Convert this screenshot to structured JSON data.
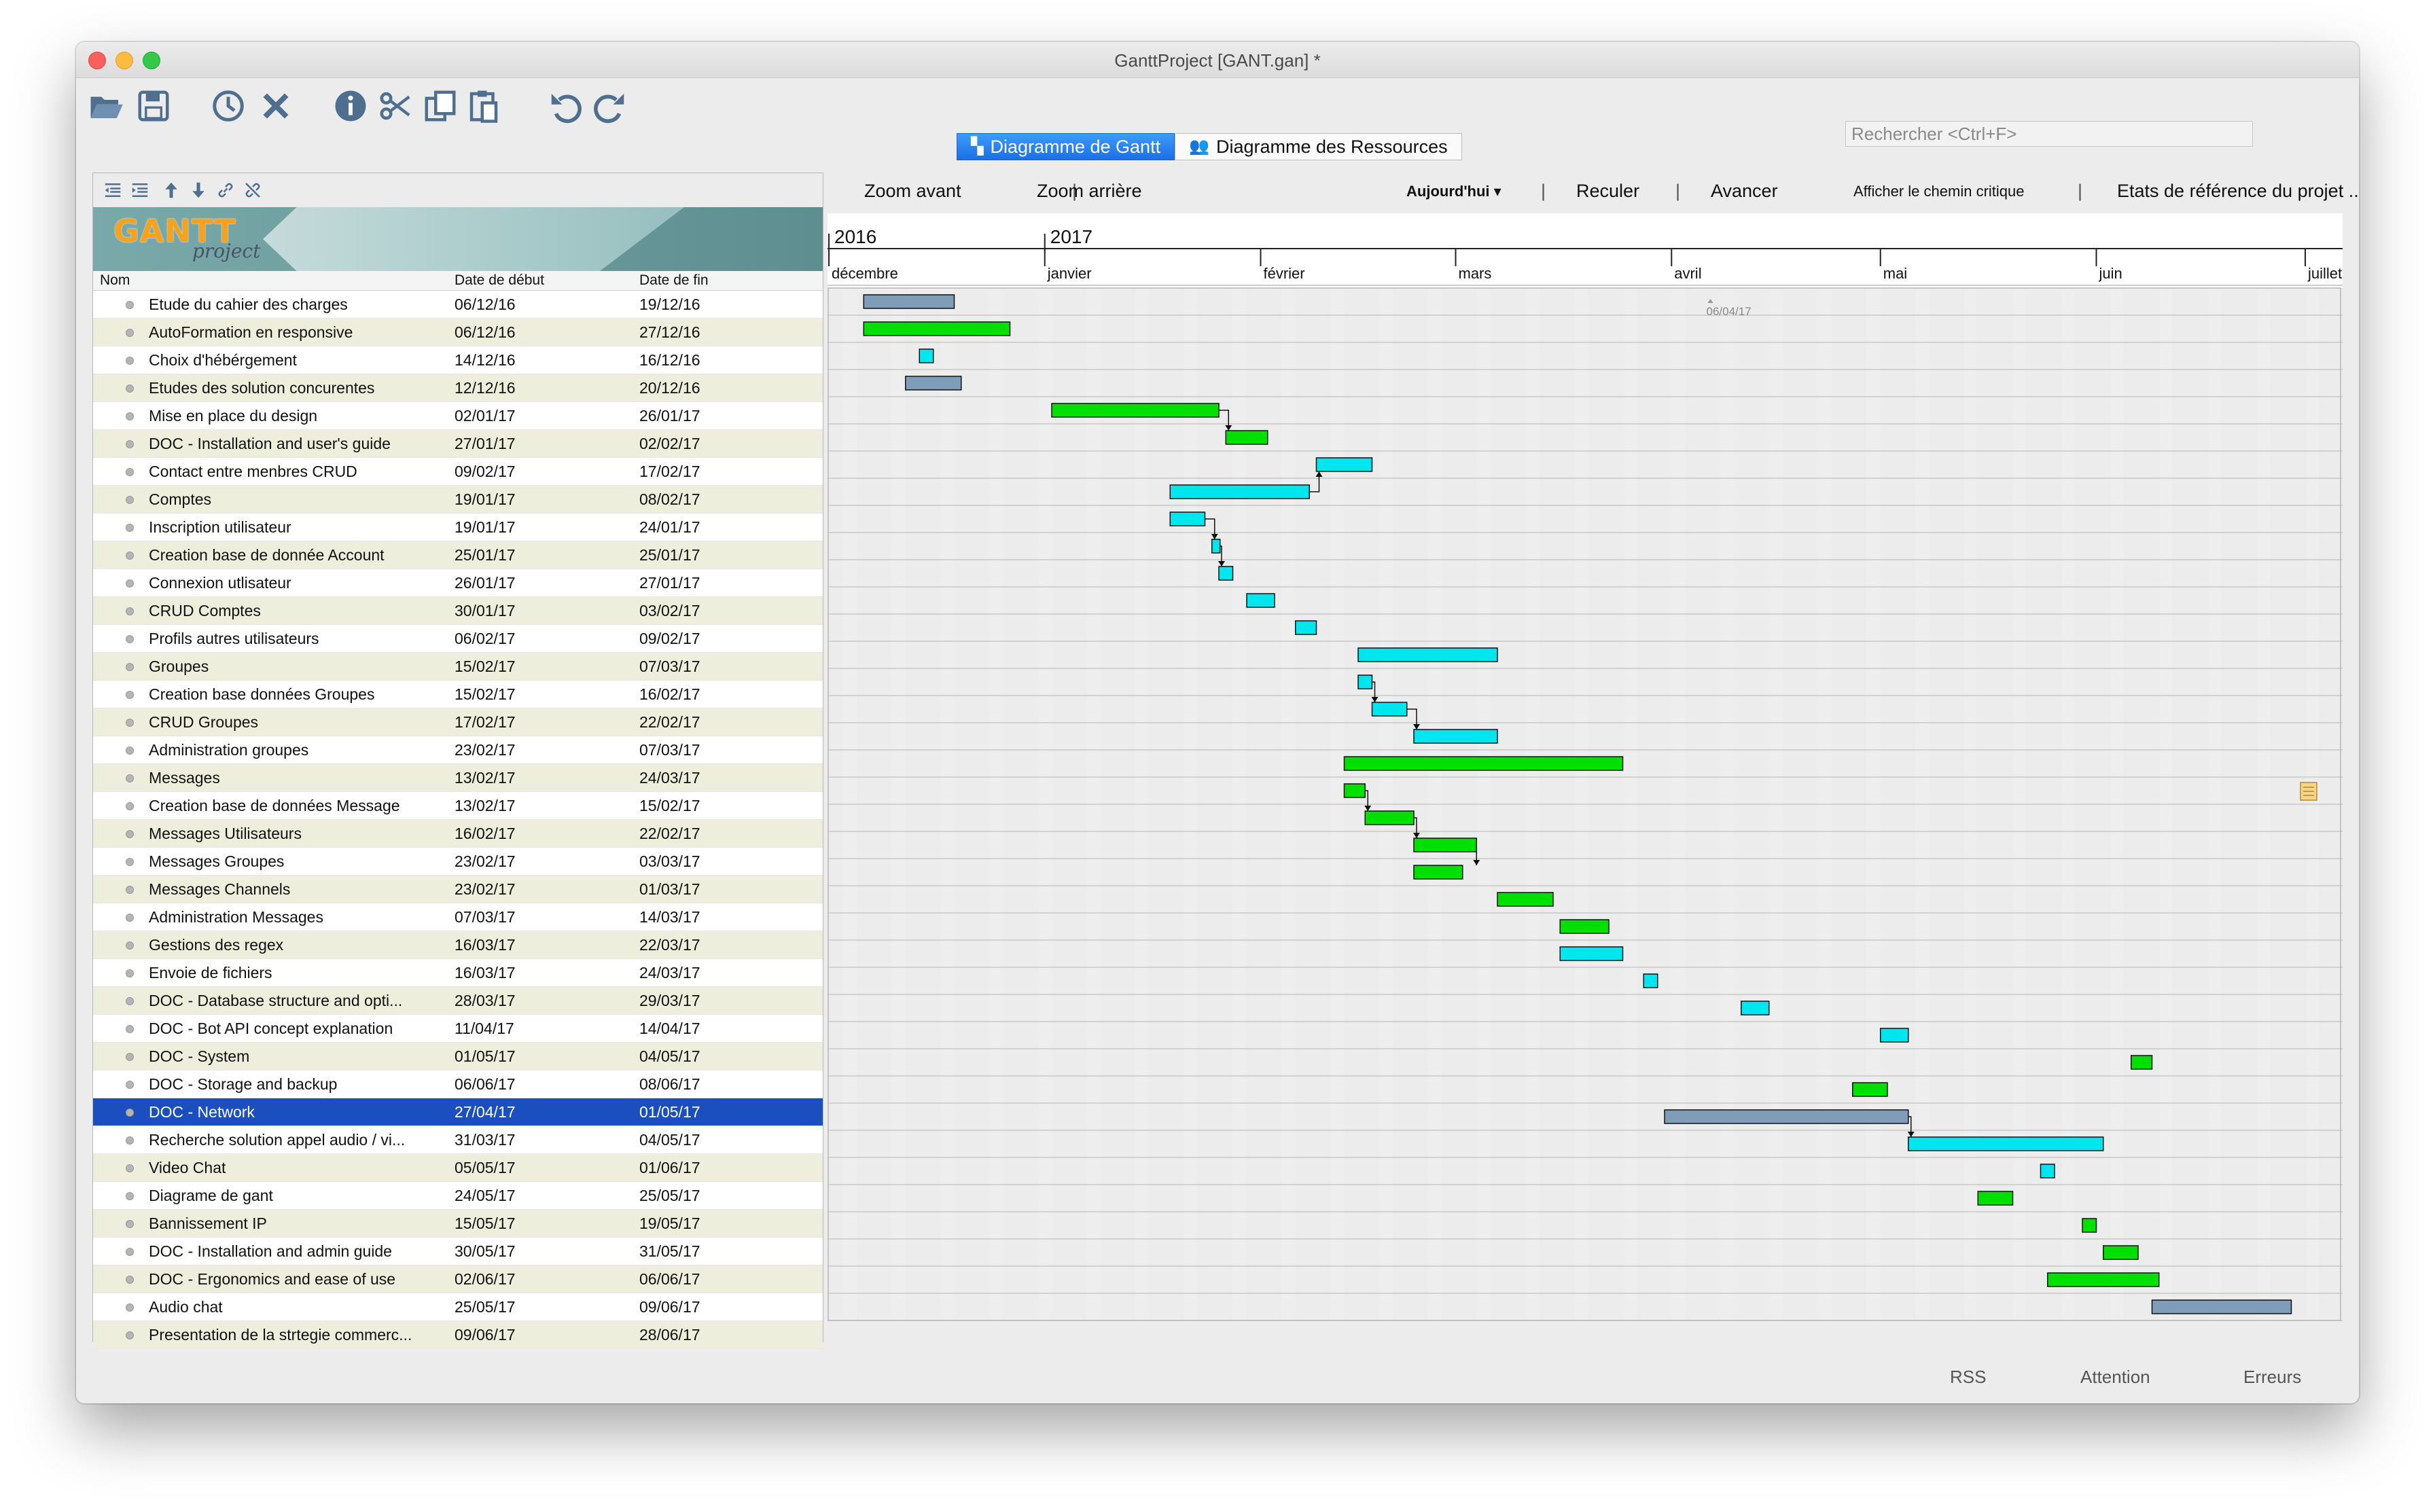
{
  "window": {
    "title": "GanttProject [GANT.gan] *"
  },
  "toolbar": {
    "buttons": [
      "open-icon",
      "save-icon",
      "history-icon",
      "delete-icon",
      "info-icon",
      "cut-icon",
      "copy-icon",
      "paste-icon",
      "undo-icon",
      "redo-icon"
    ],
    "search_placeholder": "Rechercher <Ctrl+F>"
  },
  "tabs": [
    {
      "label": "Diagramme de Gantt",
      "active": true
    },
    {
      "label": "Diagramme des Ressources",
      "active": false
    }
  ],
  "logo": {
    "text": "GANTT",
    "sub": "project"
  },
  "columns": {
    "name": "Nom",
    "start": "Date de début",
    "end": "Date de fin"
  },
  "gantt_toolbar": {
    "zoom_in": "Zoom avant",
    "zoom_out": "Zoom arrière",
    "today": "Aujourd'hui",
    "back": "Reculer",
    "forward": "Avancer",
    "critical": "Afficher le chemin critique",
    "baselines": "Etats de référence du projet ..."
  },
  "timeline": {
    "years": [
      "2016",
      "2017"
    ],
    "months": [
      "décembre",
      "janvier",
      "février",
      "mars",
      "avril",
      "mai",
      "juin",
      "juillet"
    ],
    "today_marker": "06/04/17"
  },
  "tasks": [
    {
      "name": "Etude du cahier des charges",
      "start": "06/12/16",
      "end": "19/12/16",
      "s": 5,
      "e": 18,
      "color": "#7f9db9"
    },
    {
      "name": "AutoFormation en responsive",
      "start": "06/12/16",
      "end": "27/12/16",
      "s": 5,
      "e": 26,
      "color": "#00e000"
    },
    {
      "name": "Choix d'hébérgement",
      "start": "14/12/16",
      "end": "16/12/16",
      "s": 13,
      "e": 15,
      "color": "#00e6ef"
    },
    {
      "name": "Etudes des solution concurentes",
      "start": "12/12/16",
      "end": "20/12/16",
      "s": 11,
      "e": 19,
      "color": "#7f9db9"
    },
    {
      "name": "Mise en place du design",
      "start": "02/01/17",
      "end": "26/01/17",
      "s": 32,
      "e": 56,
      "color": "#00e000"
    },
    {
      "name": "DOC - Installation and user's guide",
      "start": "27/01/17",
      "end": "02/02/17",
      "s": 57,
      "e": 63,
      "color": "#00e000"
    },
    {
      "name": "Contact entre menbres CRUD",
      "start": "09/02/17",
      "end": "17/02/17",
      "s": 70,
      "e": 78,
      "color": "#00e6ef"
    },
    {
      "name": "Comptes",
      "start": "19/01/17",
      "end": "08/02/17",
      "s": 49,
      "e": 69,
      "color": "#00e6ef"
    },
    {
      "name": "Inscription utilisateur",
      "start": "19/01/17",
      "end": "24/01/17",
      "s": 49,
      "e": 54,
      "color": "#00e6ef"
    },
    {
      "name": "Creation base de donnée Account",
      "start": "25/01/17",
      "end": "25/01/17",
      "s": 55,
      "e": 56,
      "color": "#00e6ef"
    },
    {
      "name": "Connexion utlisateur",
      "start": "26/01/17",
      "end": "27/01/17",
      "s": 56,
      "e": 58,
      "color": "#00e6ef"
    },
    {
      "name": "CRUD Comptes",
      "start": "30/01/17",
      "end": "03/02/17",
      "s": 60,
      "e": 64,
      "color": "#00e6ef"
    },
    {
      "name": "Profils autres utilisateurs",
      "start": "06/02/17",
      "end": "09/02/17",
      "s": 67,
      "e": 70,
      "color": "#00e6ef"
    },
    {
      "name": "Groupes",
      "start": "15/02/17",
      "end": "07/03/17",
      "s": 76,
      "e": 96,
      "color": "#00e6ef"
    },
    {
      "name": "Creation base données Groupes",
      "start": "15/02/17",
      "end": "16/02/17",
      "s": 76,
      "e": 78,
      "color": "#00e6ef"
    },
    {
      "name": "CRUD Groupes",
      "start": "17/02/17",
      "end": "22/02/17",
      "s": 78,
      "e": 83,
      "color": "#00e6ef"
    },
    {
      "name": "Administration groupes",
      "start": "23/02/17",
      "end": "07/03/17",
      "s": 84,
      "e": 96,
      "color": "#00e6ef"
    },
    {
      "name": "Messages",
      "start": "13/02/17",
      "end": "24/03/17",
      "s": 74,
      "e": 114,
      "color": "#00e000"
    },
    {
      "name": "Creation base de données Message",
      "start": "13/02/17",
      "end": "15/02/17",
      "s": 74,
      "e": 77,
      "color": "#00e000"
    },
    {
      "name": "Messages Utilisateurs",
      "start": "16/02/17",
      "end": "22/02/17",
      "s": 77,
      "e": 84,
      "color": "#00e000"
    },
    {
      "name": "Messages Groupes",
      "start": "23/02/17",
      "end": "03/03/17",
      "s": 84,
      "e": 93,
      "color": "#00e000"
    },
    {
      "name": "Messages Channels",
      "start": "23/02/17",
      "end": "01/03/17",
      "s": 84,
      "e": 91,
      "color": "#00e000"
    },
    {
      "name": "Administration Messages",
      "start": "07/03/17",
      "end": "14/03/17",
      "s": 96,
      "e": 104,
      "color": "#00e000"
    },
    {
      "name": "Gestions des regex",
      "start": "16/03/17",
      "end": "22/03/17",
      "s": 105,
      "e": 112,
      "color": "#00e000"
    },
    {
      "name": "Envoie de fichiers",
      "start": "16/03/17",
      "end": "24/03/17",
      "s": 105,
      "e": 114,
      "color": "#00e6ef"
    },
    {
      "name": "DOC -  Database structure and opti...",
      "start": "28/03/17",
      "end": "29/03/17",
      "s": 117,
      "e": 119,
      "color": "#00e6ef"
    },
    {
      "name": "DOC - Bot API concept explanation",
      "start": "11/04/17",
      "end": "14/04/17",
      "s": 131,
      "e": 135,
      "color": "#00e6ef"
    },
    {
      "name": "DOC - System",
      "start": "01/05/17",
      "end": "04/05/17",
      "s": 151,
      "e": 155,
      "color": "#00e6ef"
    },
    {
      "name": "DOC - Storage and backup",
      "start": "06/06/17",
      "end": "08/06/17",
      "s": 187,
      "e": 190,
      "color": "#00e000"
    },
    {
      "name": "DOC - Network",
      "start": "27/04/17",
      "end": "01/05/17",
      "s": 147,
      "e": 152,
      "color": "#00e000",
      "selected": true
    },
    {
      "name": "Recherche solution appel audio / vi...",
      "start": "31/03/17",
      "end": "04/05/17",
      "s": 120,
      "e": 155,
      "color": "#7f9db9"
    },
    {
      "name": "Video Chat",
      "start": "05/05/17",
      "end": "01/06/17",
      "s": 155,
      "e": 183,
      "color": "#00e6ef"
    },
    {
      "name": "Diagrame de gant",
      "start": "24/05/17",
      "end": "25/05/17",
      "s": 174,
      "e": 176,
      "color": "#00e6ef"
    },
    {
      "name": "Bannissement IP",
      "start": "15/05/17",
      "end": "19/05/17",
      "s": 165,
      "e": 170,
      "color": "#00e000"
    },
    {
      "name": "DOC -  Installation and admin guide",
      "start": "30/05/17",
      "end": "31/05/17",
      "s": 180,
      "e": 182,
      "color": "#00e000"
    },
    {
      "name": "DOC - Ergonomics and ease of use",
      "start": "02/06/17",
      "end": "06/06/17",
      "s": 183,
      "e": 188,
      "color": "#00e000"
    },
    {
      "name": "Audio chat",
      "start": "25/05/17",
      "end": "09/06/17",
      "s": 175,
      "e": 191,
      "color": "#00e000"
    },
    {
      "name": "Presentation de la strtegie commerc...",
      "start": "09/06/17",
      "end": "28/06/17",
      "s": 190,
      "e": 210,
      "color": "#7f9db9"
    }
  ],
  "status": {
    "rss": "RSS",
    "attention": "Attention",
    "errors": "Erreurs"
  }
}
